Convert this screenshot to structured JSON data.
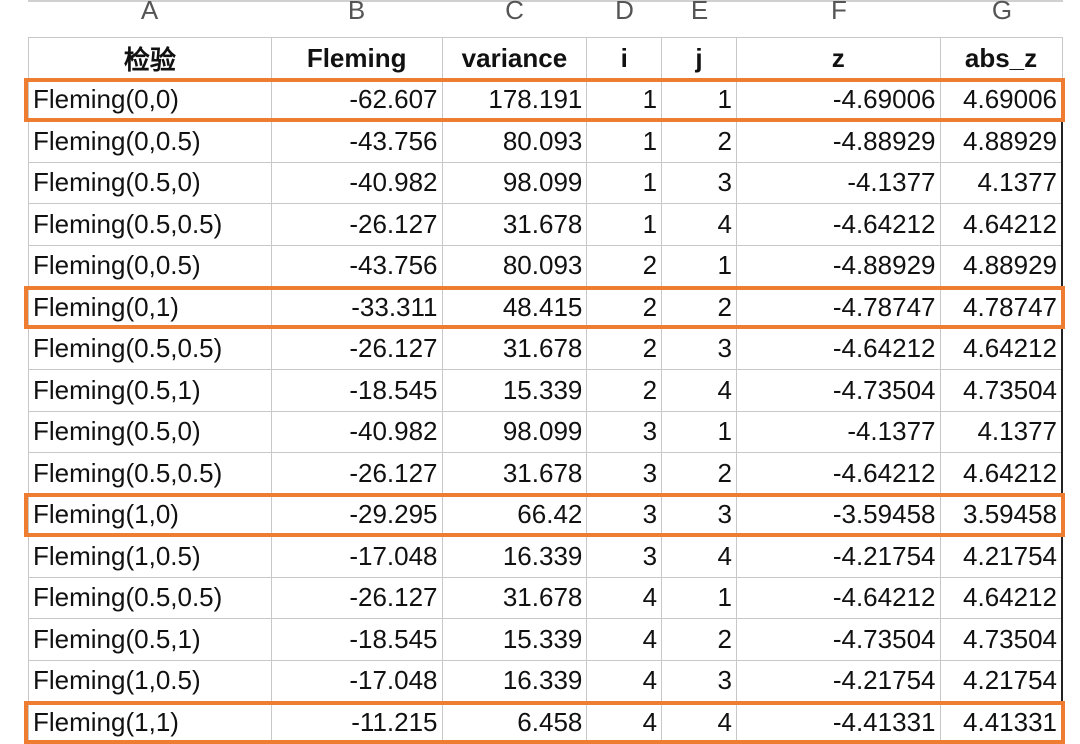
{
  "column_letters": [
    "A",
    "B",
    "C",
    "D",
    "E",
    "F",
    "G"
  ],
  "headers": [
    "检验",
    "Fleming",
    "variance",
    "i",
    "j",
    "z",
    "abs_z"
  ],
  "rows": [
    {
      "test": "Fleming(0,0)",
      "fleming": "-62.607",
      "variance": "178.191",
      "i": "1",
      "j": "1",
      "z": "-4.69006",
      "abs_z": "4.69006",
      "highlighted": true
    },
    {
      "test": "Fleming(0,0.5)",
      "fleming": "-43.756",
      "variance": "80.093",
      "i": "1",
      "j": "2",
      "z": "-4.88929",
      "abs_z": "4.88929",
      "highlighted": false
    },
    {
      "test": "Fleming(0.5,0)",
      "fleming": "-40.982",
      "variance": "98.099",
      "i": "1",
      "j": "3",
      "z": "-4.1377",
      "abs_z": "4.1377",
      "highlighted": false
    },
    {
      "test": "Fleming(0.5,0.5)",
      "fleming": "-26.127",
      "variance": "31.678",
      "i": "1",
      "j": "4",
      "z": "-4.64212",
      "abs_z": "4.64212",
      "highlighted": false
    },
    {
      "test": "Fleming(0,0.5)",
      "fleming": "-43.756",
      "variance": "80.093",
      "i": "2",
      "j": "1",
      "z": "-4.88929",
      "abs_z": "4.88929",
      "highlighted": false
    },
    {
      "test": "Fleming(0,1)",
      "fleming": "-33.311",
      "variance": "48.415",
      "i": "2",
      "j": "2",
      "z": "-4.78747",
      "abs_z": "4.78747",
      "highlighted": true
    },
    {
      "test": "Fleming(0.5,0.5)",
      "fleming": "-26.127",
      "variance": "31.678",
      "i": "2",
      "j": "3",
      "z": "-4.64212",
      "abs_z": "4.64212",
      "highlighted": false
    },
    {
      "test": "Fleming(0.5,1)",
      "fleming": "-18.545",
      "variance": "15.339",
      "i": "2",
      "j": "4",
      "z": "-4.73504",
      "abs_z": "4.73504",
      "highlighted": false
    },
    {
      "test": "Fleming(0.5,0)",
      "fleming": "-40.982",
      "variance": "98.099",
      "i": "3",
      "j": "1",
      "z": "-4.1377",
      "abs_z": "4.1377",
      "highlighted": false
    },
    {
      "test": "Fleming(0.5,0.5)",
      "fleming": "-26.127",
      "variance": "31.678",
      "i": "3",
      "j": "2",
      "z": "-4.64212",
      "abs_z": "4.64212",
      "highlighted": false
    },
    {
      "test": "Fleming(1,0)",
      "fleming": "-29.295",
      "variance": "66.42",
      "i": "3",
      "j": "3",
      "z": "-3.59458",
      "abs_z": "3.59458",
      "highlighted": true
    },
    {
      "test": "Fleming(1,0.5)",
      "fleming": "-17.048",
      "variance": "16.339",
      "i": "3",
      "j": "4",
      "z": "-4.21754",
      "abs_z": "4.21754",
      "highlighted": false
    },
    {
      "test": "Fleming(0.5,0.5)",
      "fleming": "-26.127",
      "variance": "31.678",
      "i": "4",
      "j": "1",
      "z": "-4.64212",
      "abs_z": "4.64212",
      "highlighted": false
    },
    {
      "test": "Fleming(0.5,1)",
      "fleming": "-18.545",
      "variance": "15.339",
      "i": "4",
      "j": "2",
      "z": "-4.73504",
      "abs_z": "4.73504",
      "highlighted": false
    },
    {
      "test": "Fleming(1,0.5)",
      "fleming": "-17.048",
      "variance": "16.339",
      "i": "4",
      "j": "3",
      "z": "-4.21754",
      "abs_z": "4.21754",
      "highlighted": false
    },
    {
      "test": "Fleming(1,1)",
      "fleming": "-11.215",
      "variance": "6.458",
      "i": "4",
      "j": "4",
      "z": "-4.41331",
      "abs_z": "4.41331",
      "highlighted": true
    }
  ],
  "colors": {
    "highlight": "#ee7d31",
    "grid": "#c8c8c8"
  }
}
